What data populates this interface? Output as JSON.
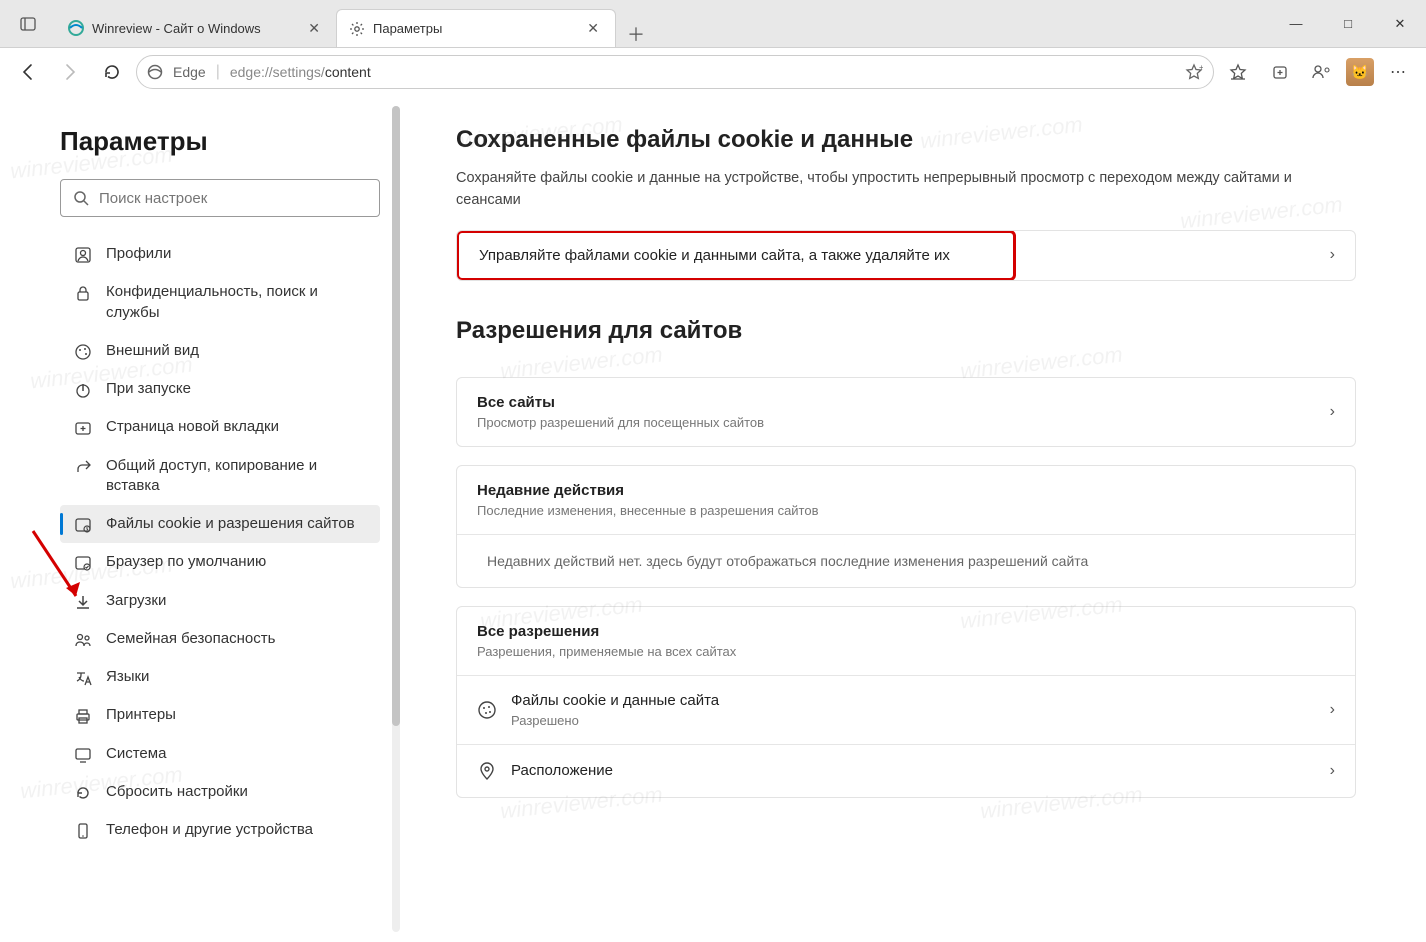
{
  "window": {
    "min": "—",
    "max": "□",
    "close": "✕"
  },
  "tabs": {
    "list": [
      {
        "title": "Winreview - Сайт о Windows",
        "icon": "edge-logo"
      },
      {
        "title": "Параметры",
        "icon": "gear"
      }
    ],
    "activeIndex": 1
  },
  "toolbar": {
    "edgeLabel": "Edge",
    "urlPrefix": "edge://settings/",
    "urlPage": "content"
  },
  "sidebar": {
    "title": "Параметры",
    "searchPlaceholder": "Поиск настроек",
    "items": [
      {
        "label": "Профили",
        "icon": "profile"
      },
      {
        "label": "Конфиденциальность, поиск и службы",
        "icon": "lock"
      },
      {
        "label": "Внешний вид",
        "icon": "palette"
      },
      {
        "label": "При запуске",
        "icon": "power"
      },
      {
        "label": "Страница новой вкладки",
        "icon": "tab"
      },
      {
        "label": "Общий доступ, копирование и вставка",
        "icon": "share"
      },
      {
        "label": "Файлы cookie и разрешения сайтов",
        "icon": "cookie-perm"
      },
      {
        "label": "Браузер по умолчанию",
        "icon": "default-browser"
      },
      {
        "label": "Загрузки",
        "icon": "download"
      },
      {
        "label": "Семейная безопасность",
        "icon": "family"
      },
      {
        "label": "Языки",
        "icon": "languages"
      },
      {
        "label": "Принтеры",
        "icon": "printer"
      },
      {
        "label": "Система",
        "icon": "system"
      },
      {
        "label": "Сбросить настройки",
        "icon": "reset"
      },
      {
        "label": "Телефон и другие устройства",
        "icon": "phone"
      }
    ],
    "activeIndex": 6
  },
  "main": {
    "h_cookies": "Сохраненные файлы cookie и данные",
    "p_cookies": "Сохраняйте файлы cookie и данные на устройстве, чтобы упростить непрерывный просмотр с переходом между сайтами и сеансами",
    "manage_cookies": "Управляйте файлами cookie и данными сайта, а также удаляйте их",
    "h_perm": "Разрешения для сайтов",
    "all_sites_t": "Все сайты",
    "all_sites_s": "Просмотр разрешений для посещенных сайтов",
    "recent_t": "Недавние действия",
    "recent_s": "Последние изменения, внесенные в разрешения сайтов",
    "recent_empty": "Недавних действий нет. здесь будут отображаться последние изменения разрешений сайта",
    "all_perm_t": "Все разрешения",
    "all_perm_s": "Разрешения, применяемые на всех сайтах",
    "cookies_t": "Файлы cookie и данные сайта",
    "cookies_s": "Разрешено",
    "location_t": "Расположение"
  },
  "watermark": "winreviewer.com"
}
